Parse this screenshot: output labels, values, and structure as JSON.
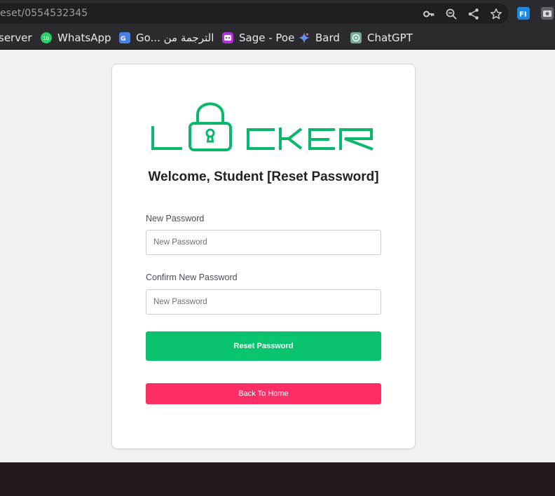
{
  "browser": {
    "url": "eset/0554532345",
    "bookmarks": [
      {
        "label": "server",
        "icon": "server-icon"
      },
      {
        "label": "WhatsApp",
        "icon": "whatsapp-icon",
        "badge": "10"
      },
      {
        "label": "Go... الترجمة من",
        "icon": "translate-icon"
      },
      {
        "label": "Sage - Poe",
        "icon": "poe-icon"
      },
      {
        "label": "Bard",
        "icon": "bard-icon"
      },
      {
        "label": "ChatGPT",
        "icon": "chatgpt-icon"
      }
    ]
  },
  "form": {
    "title": "Welcome, Student [Reset Password]",
    "new_password_label": "New Password",
    "new_password_placeholder": "New Password",
    "confirm_password_label": "Confirm New Password",
    "confirm_password_placeholder": "New Password",
    "reset_button": "Reset Password",
    "home_button": "Back To Home"
  },
  "colors": {
    "brand_green": "#09b86a",
    "reset_button": "#09c36f",
    "home_button": "#fd2d66"
  }
}
